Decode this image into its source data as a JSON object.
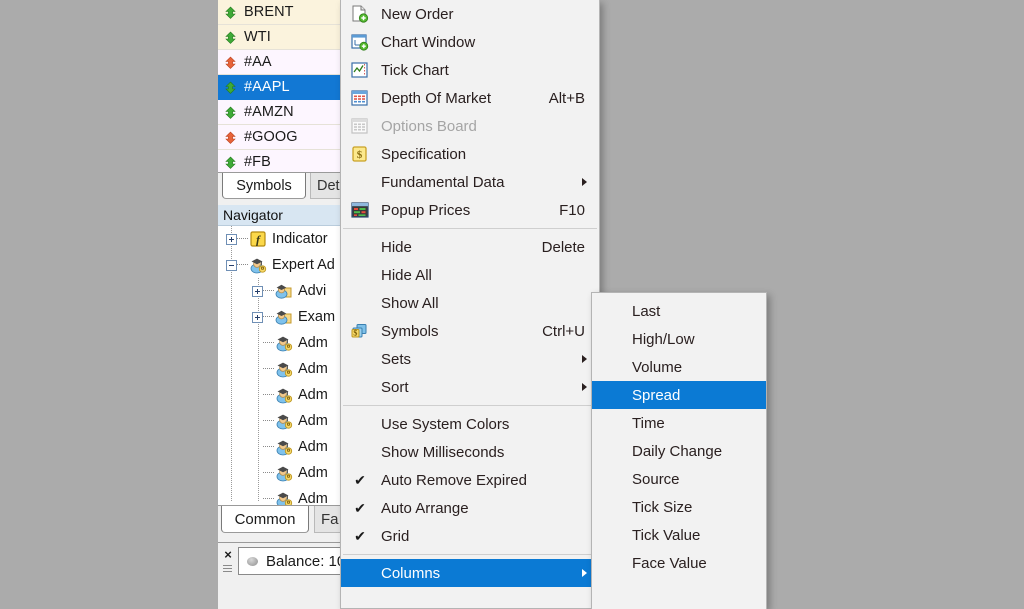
{
  "window": {
    "background_color": "#ababab"
  },
  "market_watch": {
    "rows": [
      {
        "symbol": "BRENT",
        "direction": "up",
        "selected": false,
        "tint": "tint-a"
      },
      {
        "symbol": "WTI",
        "direction": "up",
        "selected": false,
        "tint": "tint-a"
      },
      {
        "symbol": "#AA",
        "direction": "down",
        "selected": false,
        "tint": "tint-b"
      },
      {
        "symbol": "#AAPL",
        "direction": "up",
        "selected": true,
        "tint": ""
      },
      {
        "symbol": "#AMZN",
        "direction": "up",
        "selected": false,
        "tint": "tint-b"
      },
      {
        "symbol": "#GOOG",
        "direction": "down",
        "selected": false,
        "tint": "tint-b"
      },
      {
        "symbol": "#FB",
        "direction": "up",
        "selected": false,
        "tint": "tint-b"
      }
    ],
    "tabs": [
      {
        "label": "Symbols",
        "active": true
      },
      {
        "label": "Det",
        "active": false
      }
    ],
    "colors": {
      "up": "#3faa37",
      "down": "#e8633a",
      "selected_bg": "#1278d4"
    }
  },
  "navigator": {
    "title": "Navigator",
    "items": [
      {
        "label": "Indicator",
        "icon": "function-icon",
        "expander": "plus",
        "depth": 0
      },
      {
        "label": "Expert Ad",
        "icon": "expert-advisor-icon",
        "expander": "minus",
        "depth": 0
      },
      {
        "label": "Advi",
        "icon": "folder-expert-icon",
        "expander": "plus",
        "depth": 1
      },
      {
        "label": "Exam",
        "icon": "folder-expert-icon",
        "expander": "plus",
        "depth": 1
      },
      {
        "label": "Adm",
        "icon": "expert-advisor-icon",
        "expander": "none",
        "depth": 1
      },
      {
        "label": "Adm",
        "icon": "expert-advisor-icon",
        "expander": "none",
        "depth": 1
      },
      {
        "label": "Adm",
        "icon": "expert-advisor-icon",
        "expander": "none",
        "depth": 1
      },
      {
        "label": "Adm",
        "icon": "expert-advisor-icon",
        "expander": "none",
        "depth": 1
      },
      {
        "label": "Adm",
        "icon": "expert-advisor-icon",
        "expander": "none",
        "depth": 1
      },
      {
        "label": "Adm",
        "icon": "expert-advisor-icon",
        "expander": "none",
        "depth": 1
      },
      {
        "label": "Adm",
        "icon": "expert-advisor-icon",
        "expander": "none",
        "depth": 1
      }
    ],
    "tabs": [
      {
        "label": "Common",
        "active": true
      },
      {
        "label": "Fa",
        "active": false
      }
    ]
  },
  "terminal": {
    "close_label": "×",
    "balance_label": "Balance: 10"
  },
  "context_menu": {
    "items": [
      {
        "kind": "item",
        "label": "New Order",
        "accel": "",
        "icon": "new-order-icon",
        "state": "normal"
      },
      {
        "kind": "item",
        "label": "Chart Window",
        "accel": "",
        "icon": "chart-window-icon",
        "state": "normal"
      },
      {
        "kind": "item",
        "label": "Tick Chart",
        "accel": "",
        "icon": "tick-chart-icon",
        "state": "normal"
      },
      {
        "kind": "item",
        "label": "Depth Of Market",
        "accel": "Alt+B",
        "icon": "depth-market-icon",
        "state": "normal"
      },
      {
        "kind": "item",
        "label": "Options Board",
        "accel": "",
        "icon": "options-board-icon",
        "state": "disabled"
      },
      {
        "kind": "item",
        "label": "Specification",
        "accel": "",
        "icon": "specification-icon",
        "state": "normal"
      },
      {
        "kind": "submenu",
        "label": "Fundamental Data",
        "accel": "",
        "icon": "none",
        "state": "normal"
      },
      {
        "kind": "item",
        "label": "Popup Prices",
        "accel": "F10",
        "icon": "popup-prices-icon",
        "state": "normal"
      },
      {
        "kind": "separator"
      },
      {
        "kind": "item",
        "label": "Hide",
        "accel": "Delete",
        "icon": "none",
        "state": "normal"
      },
      {
        "kind": "item",
        "label": "Hide All",
        "accel": "",
        "icon": "none",
        "state": "normal"
      },
      {
        "kind": "item",
        "label": "Show All",
        "accel": "",
        "icon": "none",
        "state": "normal"
      },
      {
        "kind": "item",
        "label": "Symbols",
        "accel": "Ctrl+U",
        "icon": "symbols-icon",
        "state": "normal"
      },
      {
        "kind": "submenu",
        "label": "Sets",
        "accel": "",
        "icon": "none",
        "state": "normal"
      },
      {
        "kind": "submenu",
        "label": "Sort",
        "accel": "",
        "icon": "none",
        "state": "normal"
      },
      {
        "kind": "separator"
      },
      {
        "kind": "item",
        "label": "Use System Colors",
        "accel": "",
        "icon": "none",
        "state": "normal"
      },
      {
        "kind": "item",
        "label": "Show Milliseconds",
        "accel": "",
        "icon": "none",
        "state": "normal"
      },
      {
        "kind": "check",
        "label": "Auto Remove Expired",
        "accel": "",
        "icon": "check-icon",
        "state": "checked"
      },
      {
        "kind": "check",
        "label": "Auto Arrange",
        "accel": "",
        "icon": "check-icon",
        "state": "checked"
      },
      {
        "kind": "check",
        "label": "Grid",
        "accel": "",
        "icon": "check-icon",
        "state": "checked"
      },
      {
        "kind": "separator"
      },
      {
        "kind": "submenu",
        "label": "Columns",
        "accel": "",
        "icon": "none",
        "state": "highlighted"
      }
    ]
  },
  "columns_submenu": {
    "items": [
      {
        "label": "Last",
        "highlighted": false
      },
      {
        "label": "High/Low",
        "highlighted": false
      },
      {
        "label": "Volume",
        "highlighted": false
      },
      {
        "label": "Spread",
        "highlighted": true
      },
      {
        "label": "Time",
        "highlighted": false
      },
      {
        "label": "Daily Change",
        "highlighted": false
      },
      {
        "label": "Source",
        "highlighted": false
      },
      {
        "label": "Tick Size",
        "highlighted": false
      },
      {
        "label": "Tick Value",
        "highlighted": false
      },
      {
        "label": "Face Value",
        "highlighted": false
      }
    ],
    "highlight_color": "#0b7ad4"
  }
}
